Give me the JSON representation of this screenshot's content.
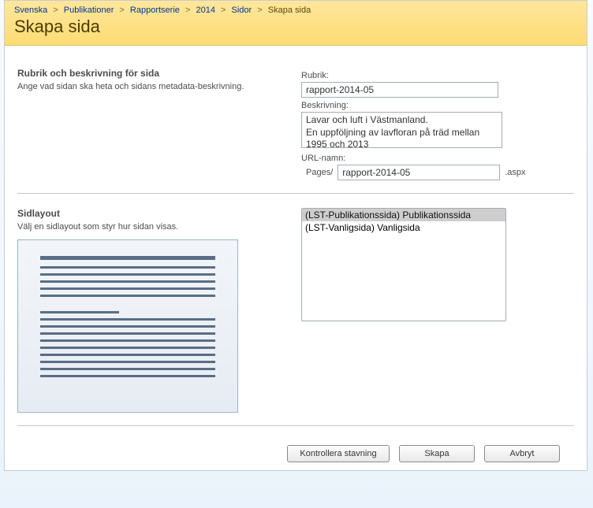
{
  "breadcrumb": {
    "items": [
      {
        "label": "Svenska"
      },
      {
        "label": "Publikationer"
      },
      {
        "label": "Rapportserie"
      },
      {
        "label": "2014"
      },
      {
        "label": "Sidor"
      }
    ],
    "current": "Skapa sida",
    "separator": ">"
  },
  "page_title": "Skapa sida",
  "section_rubrik": {
    "heading": "Rubrik och beskrivning för sida",
    "desc": "Ange vad sidan ska heta och sidans metadata-beskrivning.",
    "rubrik_label": "Rubrik:",
    "rubrik_value": "rapport-2014-05",
    "beskrivning_label": "Beskrivning:",
    "beskrivning_value": "Lavar och luft i Västmanland.\nEn uppföljning av lavfloran på träd mellan 1995 och 2013",
    "url_label": "URL-namn:",
    "url_prefix": "Pages/",
    "url_value": "rapport-2014-05",
    "url_suffix": ".aspx"
  },
  "section_layout": {
    "heading": "Sidlayout",
    "desc": "Välj en sidlayout som styr hur sidan visas.",
    "options": [
      "(LST-Publikationssida) Publikationssida",
      "(LST-Vanligsida) Vanligsida"
    ],
    "selected_index": 0
  },
  "buttons": {
    "spellcheck": "Kontrollera stavning",
    "create": "Skapa",
    "cancel": "Avbryt"
  }
}
